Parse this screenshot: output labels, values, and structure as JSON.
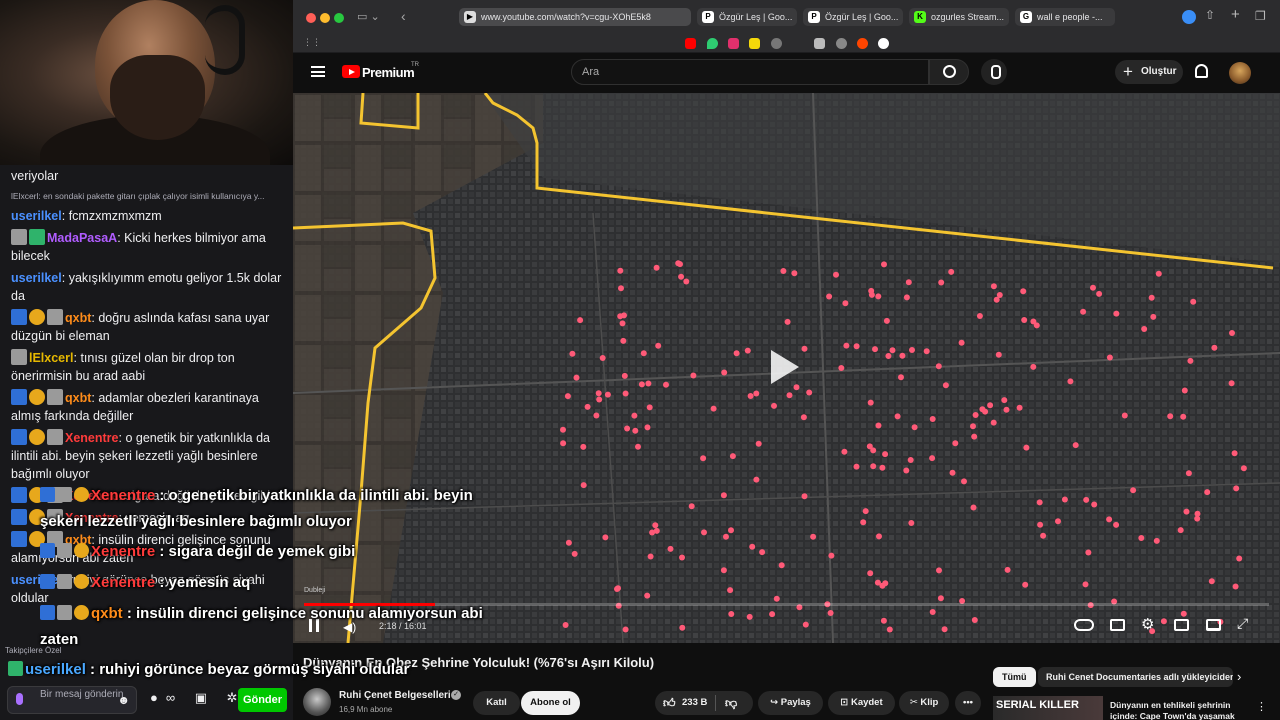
{
  "chat": {
    "messages": [
      {
        "kind": "text",
        "text": "veriyolar"
      },
      {
        "kind": "reply",
        "text": "lElxcerl: en sondaki pakette gitarı çıplak çalıyor isimli kullanıcıya y..."
      },
      {
        "kind": "msg",
        "user": "userilkel",
        "color": "#4a90ff",
        "badges": [],
        "text": "fcmzxmzmxmzm"
      },
      {
        "kind": "msg",
        "user": "MadaPasaA",
        "color": "#b05cff",
        "badges": [
          "gray",
          "green"
        ],
        "text": "Kicki herkes bilmiyor ama bilecek"
      },
      {
        "kind": "msg",
        "user": "userilkel",
        "color": "#4a90ff",
        "badges": [],
        "text": "yakışıklıyımm emotu geliyor 1.5k dolar da"
      },
      {
        "kind": "msg",
        "user": "qxbt",
        "color": "#ff8c1a",
        "badges": [
          "blue",
          "gold",
          "gray"
        ],
        "text": "doğru aslında kafası sana uyar düzgün bi eleman"
      },
      {
        "kind": "msg",
        "user": "lElxcerl",
        "color": "#e6b800",
        "badges": [
          "gray"
        ],
        "text": "tınısı güzel olan bir drop ton önerirmisin bu arad aabi"
      },
      {
        "kind": "msg",
        "user": "qxbt",
        "color": "#ff8c1a",
        "badges": [
          "blue",
          "gold",
          "gray"
        ],
        "text": "adamlar obezleri karantinaya almış farkında değiller"
      },
      {
        "kind": "msg",
        "user": "Xenentre",
        "color": "#ff3b3b",
        "badges": [
          "blue",
          "gold",
          "gray"
        ],
        "text": "o genetik bir yatkınlıkla da ilintili abi. beyin şekeri lezzetli yağlı besinlere bağımlı oluyor"
      },
      {
        "kind": "msg",
        "user": "Xenentre",
        "color": "#ff3b3b",
        "badges": [
          "blue",
          "gold",
          "gray"
        ],
        "text": "sigara değil de yemek gibi"
      },
      {
        "kind": "msg",
        "user": "Xenentre",
        "color": "#ff3b3b",
        "badges": [
          "blue",
          "gold",
          "gray"
        ],
        "text": "yemesin aq"
      },
      {
        "kind": "msg",
        "user": "qxbt",
        "color": "#ff8c1a",
        "badges": [
          "blue",
          "gold",
          "gray"
        ],
        "text": "insülin direnci gelişince sonunu alamıyorsun abi zaten"
      },
      {
        "kind": "msg",
        "user": "userilkel",
        "color": "#4a90ff",
        "badges": [],
        "text": "ruhiyi görünce beyaz görmüş siyahi oldular"
      }
    ],
    "followers_only": "Takipçilere Özel",
    "input_placeholder": "Bir mesaj gönderin",
    "send_label": "Gönder"
  },
  "overlay": [
    {
      "user": "Xenentre",
      "text": " : o genetik bir yatkınlıkla da ilintili abi. beyin",
      "badges": [
        "blue",
        "gray",
        "gold"
      ],
      "cont": false
    },
    {
      "user": "",
      "text": "şekeri lezzetli yağlı besinlere bağımlı oluyor",
      "badges": [],
      "cont": true
    },
    {
      "user": "Xenentre",
      "text": " : sigara değil de yemek gibi",
      "badges": [
        "blue",
        "gray",
        "gold"
      ],
      "cont": false
    },
    {
      "user": "Xenentre",
      "text": " : yemesin aq",
      "badges": [
        "blue",
        "gray",
        "gold"
      ],
      "cont": false
    },
    {
      "user": "qxbt",
      "text": " : insülin direnci gelişince sonunu alamıyorsun abi",
      "badges": [
        "blue",
        "gray",
        "gold"
      ],
      "cont": false
    },
    {
      "user": "",
      "text": "zaten",
      "badges": [],
      "cont": true
    },
    {
      "user": "userilkel",
      "text": " : ruhiyi görünce beyaz görmüş siyahi oldular",
      "badges": [
        "green"
      ],
      "cont": false
    }
  ],
  "browser": {
    "url": "www.youtube.com/watch?v=cgu-XOhE5k8",
    "tabs": [
      {
        "label": "Özgür Leş | Goo...",
        "fav": "P"
      },
      {
        "label": "Özgür Leş | Goo...",
        "fav": "P"
      },
      {
        "label": "ozgurles Stream...",
        "fav": "K"
      },
      {
        "label": "wall e people -...",
        "fav": "G"
      }
    ],
    "colors": {
      "close": "#ff5f57",
      "minimize": "#febc2e",
      "maximize": "#28c840"
    }
  },
  "youtube": {
    "logo_text": "Premium",
    "logo_sup": "TR",
    "search_placeholder": "Ara",
    "create_label": "Oluştur",
    "player": {
      "chapter": "Dubleji",
      "time": "2:18 / 16:01",
      "progress": 0.136
    },
    "video_title": "Dünyanın En Obez Şehrine Yolculuk! (%76'sı Aşırı Kilolu)",
    "channel": {
      "name": "Ruhi Çenet Belgeselleri",
      "subs": "16,9 Mn abone",
      "join": "Katıl",
      "subscribe": "Abone ol"
    },
    "actions": {
      "likes": "233 B",
      "share": "Paylaş",
      "save": "Kaydet",
      "clip": "Klip"
    },
    "chips": {
      "all": "Tümü",
      "ruhi": "Ruhi Cenet Documentaries adlı yükleyiciden"
    },
    "recommended": {
      "thumb_text": "SERIAL KILLER",
      "title": "Dünyanın en tehlikeli şehrinin içinde: Cape Town'da yaşamak"
    }
  }
}
